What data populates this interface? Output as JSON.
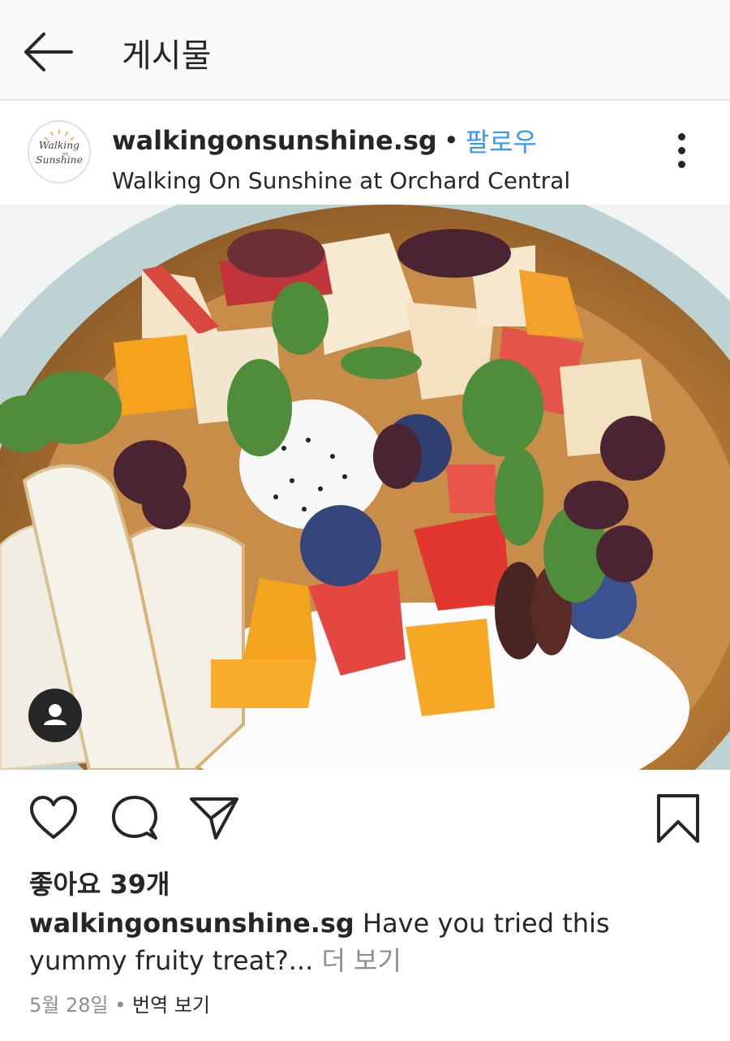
{
  "topbar": {
    "title": "게시물"
  },
  "post": {
    "username": "walkingonsunshine.sg",
    "separator": "•",
    "follow_label": "팔로우",
    "location": "Walking On Sunshine at Orchard Central",
    "avatar_logo_text": [
      "Walking",
      "on",
      "Sunshine"
    ],
    "likes": "좋아요 39개",
    "caption_user": "walkingonsunshine.sg",
    "caption_text": "Have you tried this yummy fruity treat?...",
    "caption_more": "더 보기",
    "date": "5월 28일",
    "meta_sep": "•",
    "translate_label": "번역 보기"
  },
  "icons": {
    "back": "arrow-left-icon",
    "more": "more-vertical-icon",
    "like": "heart-icon",
    "comment": "comment-icon",
    "share": "send-icon",
    "save": "bookmark-icon",
    "tag": "user-tag-icon"
  },
  "colors": {
    "link": "#3897f0",
    "text": "#262626",
    "muted": "#8e8e8e",
    "topbar_bg": "#fafafa"
  }
}
